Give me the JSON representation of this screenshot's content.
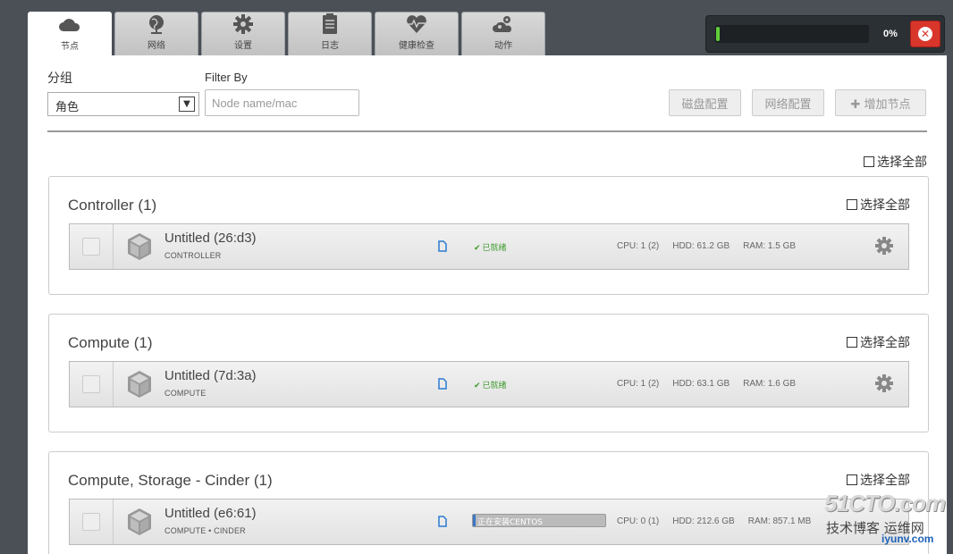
{
  "tabs": [
    {
      "label": "节点",
      "icon": "cloud-icon",
      "active": true
    },
    {
      "label": "网络",
      "icon": "globe-icon",
      "active": false
    },
    {
      "label": "设置",
      "icon": "gear-icon",
      "active": false
    },
    {
      "label": "日志",
      "icon": "clipboard-icon",
      "active": false
    },
    {
      "label": "健康检查",
      "icon": "heart-pulse-icon",
      "active": false
    },
    {
      "label": "动作",
      "icon": "cogs-cloud-icon",
      "active": false
    }
  ],
  "deploy_progress": {
    "percent_label": "0%",
    "fill_fraction": 0.02
  },
  "toolbar": {
    "group_label": "分组",
    "group_value": "角色",
    "filter_label": "Filter By",
    "filter_placeholder": "Node name/mac",
    "disk_config_label": "磁盘配置",
    "network_config_label": "网络配置",
    "add_node_label": "✚ 增加节点"
  },
  "select_all_label": "选择全部",
  "groups": [
    {
      "title": "Controller (1)",
      "select_all": "选择全部",
      "node": {
        "name": "Untitled (26:d3)",
        "roles": "CONTROLLER",
        "status": "已就绪",
        "cpu": "CPU: 1 (2)",
        "hdd": "HDD: 61.2 GB",
        "ram": "RAM: 1.5 GB"
      }
    },
    {
      "title": "Compute (1)",
      "select_all": "选择全部",
      "node": {
        "name": "Untitled (7d:3a)",
        "roles": "COMPUTE",
        "status": "已就绪",
        "cpu": "CPU: 1 (2)",
        "hdd": "HDD: 63.1 GB",
        "ram": "RAM: 1.6 GB"
      }
    },
    {
      "title": "Compute, Storage - Cinder (1)",
      "select_all": "选择全部",
      "node": {
        "name": "Untitled (e6:61)",
        "roles": "COMPUTE • CINDER",
        "install_status": "正在安装CENTOS",
        "install_fraction": 0.02,
        "cpu": "CPU: 0 (1)",
        "hdd": "HDD: 212.6 GB",
        "ram": "RAM: 857.1 MB"
      }
    }
  ],
  "watermark": {
    "brand": "51CTO.com",
    "tagline": "技术博客 运维网",
    "url": "iyunv.com"
  }
}
